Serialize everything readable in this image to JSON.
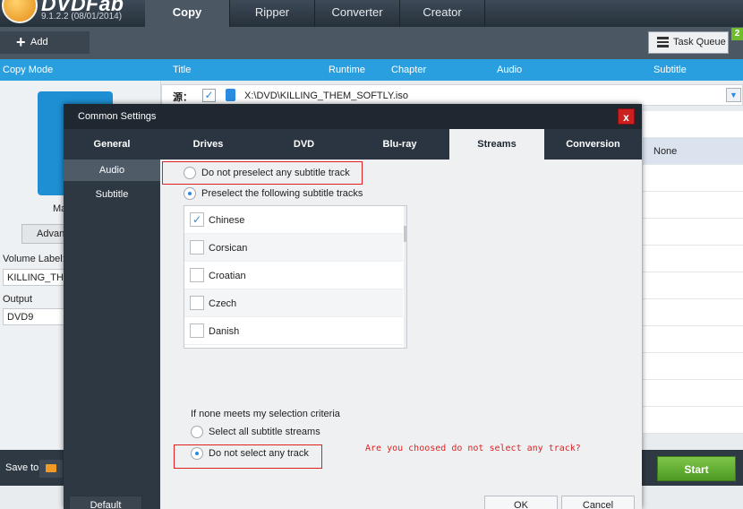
{
  "app": {
    "brand": "DVDFab",
    "version": "9.1.2.2 (08/01/2014)",
    "tabs": [
      "Copy",
      "Ripper",
      "Converter",
      "Creator"
    ],
    "active_tab": "Copy"
  },
  "toolbar": {
    "add_label": "Add",
    "task_queue_label": "Task Queue",
    "queue_badge": "2"
  },
  "columns": {
    "copy_mode": "Copy Mode",
    "title": "Title",
    "runtime": "Runtime",
    "chapter": "Chapter",
    "audio": "Audio",
    "subtitle": "Subtitle"
  },
  "source": {
    "label": "源：",
    "path": "X:\\DVD\\KILLING_THEM_SOFTLY.iso"
  },
  "left_panel": {
    "mode_partial": "Ma",
    "advanced_partial": "Advan",
    "volume_label_partial": "Volume Label:(",
    "volume_value_partial": "KILLING_THE",
    "output_label": "Output",
    "output_value": "DVD9"
  },
  "list": {
    "subtitle_value": "None"
  },
  "bottom": {
    "save_to_label": "Save to:",
    "start_label": "Start"
  },
  "dialog": {
    "title": "Common Settings",
    "close_label": "x",
    "tabs": [
      "General",
      "Drives",
      "DVD",
      "Blu-ray",
      "Streams",
      "Conversion"
    ],
    "active_tab": "Streams",
    "side_items": [
      "Audio",
      "Subtitle"
    ],
    "active_side": "Subtitle",
    "option_no_preselect": "Do not preselect any subtitle track",
    "option_preselect": "Preselect the following subtitle tracks",
    "tracks": [
      {
        "name": "Chinese",
        "checked": true
      },
      {
        "name": "Corsican",
        "checked": false
      },
      {
        "name": "Croatian",
        "checked": false
      },
      {
        "name": "Czech",
        "checked": false
      },
      {
        "name": "Danish",
        "checked": false
      }
    ],
    "criteria_label": "If none meets my selection criteria",
    "option_select_all": "Select all subtitle streams",
    "option_select_none": "Do not select any track",
    "annotation": "Are you choosed do not select any track?",
    "default_label": "Default",
    "ok_label": "OK",
    "cancel_label": "Cancel"
  }
}
